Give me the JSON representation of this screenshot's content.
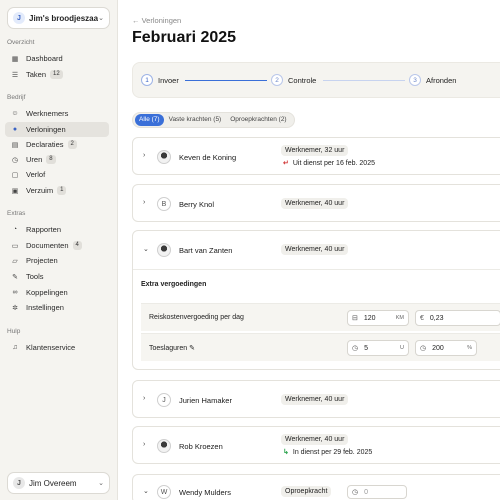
{
  "sidebar": {
    "company": {
      "initial": "J",
      "name": "Jim's broodjeszaak"
    },
    "sections": {
      "overzicht": "Overzicht",
      "bedrijf": "Bedrijf",
      "extras": "Extras",
      "hulp": "Hulp"
    },
    "items": [
      {
        "label": "Dashboard",
        "icon": "grid-icon"
      },
      {
        "label": "Taken",
        "icon": "list-icon",
        "badge": "12"
      },
      {
        "label": "Werknemers",
        "icon": "users-icon"
      },
      {
        "label": "Verloningen",
        "icon": "payroll-icon"
      },
      {
        "label": "Declaraties",
        "icon": "receipt-icon",
        "badge": "2"
      },
      {
        "label": "Uren",
        "icon": "clock-icon",
        "badge": "8"
      },
      {
        "label": "Verlof",
        "icon": "calendar-icon"
      },
      {
        "label": "Verzuim",
        "icon": "calendar-sick-icon",
        "badge": "1"
      },
      {
        "label": "Rapporten",
        "icon": "chart-icon"
      },
      {
        "label": "Documenten",
        "icon": "document-icon",
        "badge": "4"
      },
      {
        "label": "Projecten",
        "icon": "folder-icon"
      },
      {
        "label": "Tools",
        "icon": "wrench-icon"
      },
      {
        "label": "Koppelingen",
        "icon": "link-icon"
      },
      {
        "label": "Instellingen",
        "icon": "gear-icon"
      },
      {
        "label": "Klantenservice",
        "icon": "headset-icon"
      }
    ],
    "user": {
      "initial": "J",
      "name": "Jim Overeem"
    }
  },
  "main": {
    "breadcrumb": "Verloningen",
    "title": "Februari 2025",
    "steps": [
      {
        "num": "1",
        "label": "Invoer"
      },
      {
        "num": "2",
        "label": "Controle"
      },
      {
        "num": "3",
        "label": "Afronden"
      }
    ],
    "filters": [
      "Alle (7)",
      "Vaste krachten (5)",
      "Oproepkrachten (2)"
    ],
    "employees": [
      {
        "name": "Keven de Koning",
        "role": "Werknemer, 32 uur",
        "note": "Uit dienst per 16 feb. 2025"
      },
      {
        "name": "Berry Knol",
        "initial": "B",
        "role": "Werknemer, 40 uur"
      },
      {
        "name": "Bart van Zanten",
        "role": "Werknemer, 40 uur"
      },
      {
        "name": "Jurien Hamaker",
        "initial": "J",
        "role": "Werknemer, 40 uur"
      },
      {
        "name": "Rob Kroezen",
        "role": "Werknemer, 40 uur",
        "note": "In dienst per 29 feb. 2025"
      },
      {
        "name": "Wendy Mulders",
        "initial": "W",
        "role": "Oproepkracht",
        "hours": "0"
      }
    ],
    "extra": {
      "title": "Extra vergoedingen",
      "travel": {
        "label": "Reiskostenvergoeding per dag",
        "km": "120",
        "km_unit": "KM",
        "currency": "€",
        "amount": "0,23"
      },
      "surcharge": {
        "label": "Toeslaguren",
        "hours": "5",
        "hours_unit": "U",
        "percent": "200",
        "percent_unit": "%"
      }
    }
  }
}
